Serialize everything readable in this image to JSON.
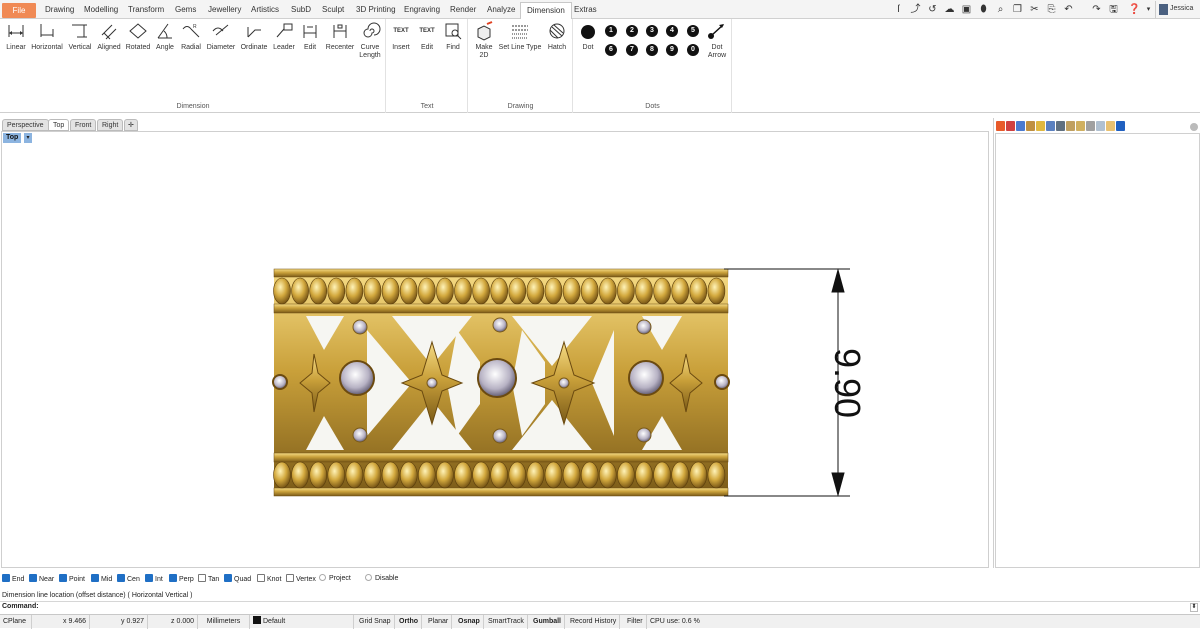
{
  "menubar": {
    "tabs": [
      "File",
      "Drawing",
      "Modelling",
      "Transform",
      "Gems",
      "Jewellery",
      "Artistics",
      "SubD",
      "Sculpt",
      "3D Printing",
      "Engraving",
      "Render",
      "Analyze",
      "Dimension",
      "Extras"
    ],
    "active_tab": "Dimension",
    "user": "Jessica"
  },
  "ribbon": {
    "groups": {
      "dimension": "Dimension",
      "text": "Text",
      "drawing": "Drawing",
      "dots": "Dots"
    },
    "dimension_tools": [
      "Linear",
      "Horizontal",
      "Vertical",
      "Aligned",
      "Rotated",
      "Angle",
      "Radial",
      "Diameter",
      "Ordinate",
      "Leader",
      "Edit",
      "Recenter",
      "Curve\nLength"
    ],
    "text_tools": [
      "Insert",
      "Edit",
      "Find"
    ],
    "text_icon": "TEXT",
    "drawing_tools": [
      "Make\n2D",
      "Set Line Type",
      "Hatch"
    ],
    "dots_tools": {
      "dot": "Dot",
      "dot_arrow": "Dot\nArrow"
    },
    "dot_numbers": [
      "1",
      "2",
      "3",
      "4",
      "5",
      "6",
      "7",
      "8",
      "9",
      "0"
    ]
  },
  "viewport": {
    "tabs": [
      "Perspective",
      "Top",
      "Front",
      "Right"
    ],
    "active_tab": "Top",
    "label": "Top",
    "dimension_value": "9.90"
  },
  "osnap": [
    {
      "label": "End",
      "checked": true
    },
    {
      "label": "Near",
      "checked": true
    },
    {
      "label": "Point",
      "checked": true
    },
    {
      "label": "Mid",
      "checked": true
    },
    {
      "label": "Cen",
      "checked": true
    },
    {
      "label": "Int",
      "checked": true
    },
    {
      "label": "Perp",
      "checked": true
    },
    {
      "label": "Tan",
      "checked": false
    },
    {
      "label": "Quad",
      "checked": true
    },
    {
      "label": "Knot",
      "checked": false
    },
    {
      "label": "Vertex",
      "checked": false
    },
    {
      "label": "Project",
      "checked": false
    },
    {
      "label": "Disable",
      "checked": false
    }
  ],
  "command": {
    "prompt": "Dimension line location (offset distance) ( Horizontal  Vertical )",
    "label": "Command:",
    "value": ""
  },
  "status": {
    "cplane": "CPlane",
    "x": "x 9.466",
    "y": "y 0.927",
    "z": "z 0.000",
    "units": "Millimeters",
    "layer": "Default",
    "toggles": [
      "Grid Snap",
      "Ortho",
      "Planar",
      "Osnap",
      "SmartTrack",
      "Gumball",
      "Record History",
      "Filter"
    ],
    "cpu": "CPU use: 0.6 %"
  },
  "colors": {
    "file_tab": "#f08a55",
    "gold": "#c9a03a",
    "checkbox": "#1f6fc5",
    "viewport_label": "#8cb4e0"
  }
}
